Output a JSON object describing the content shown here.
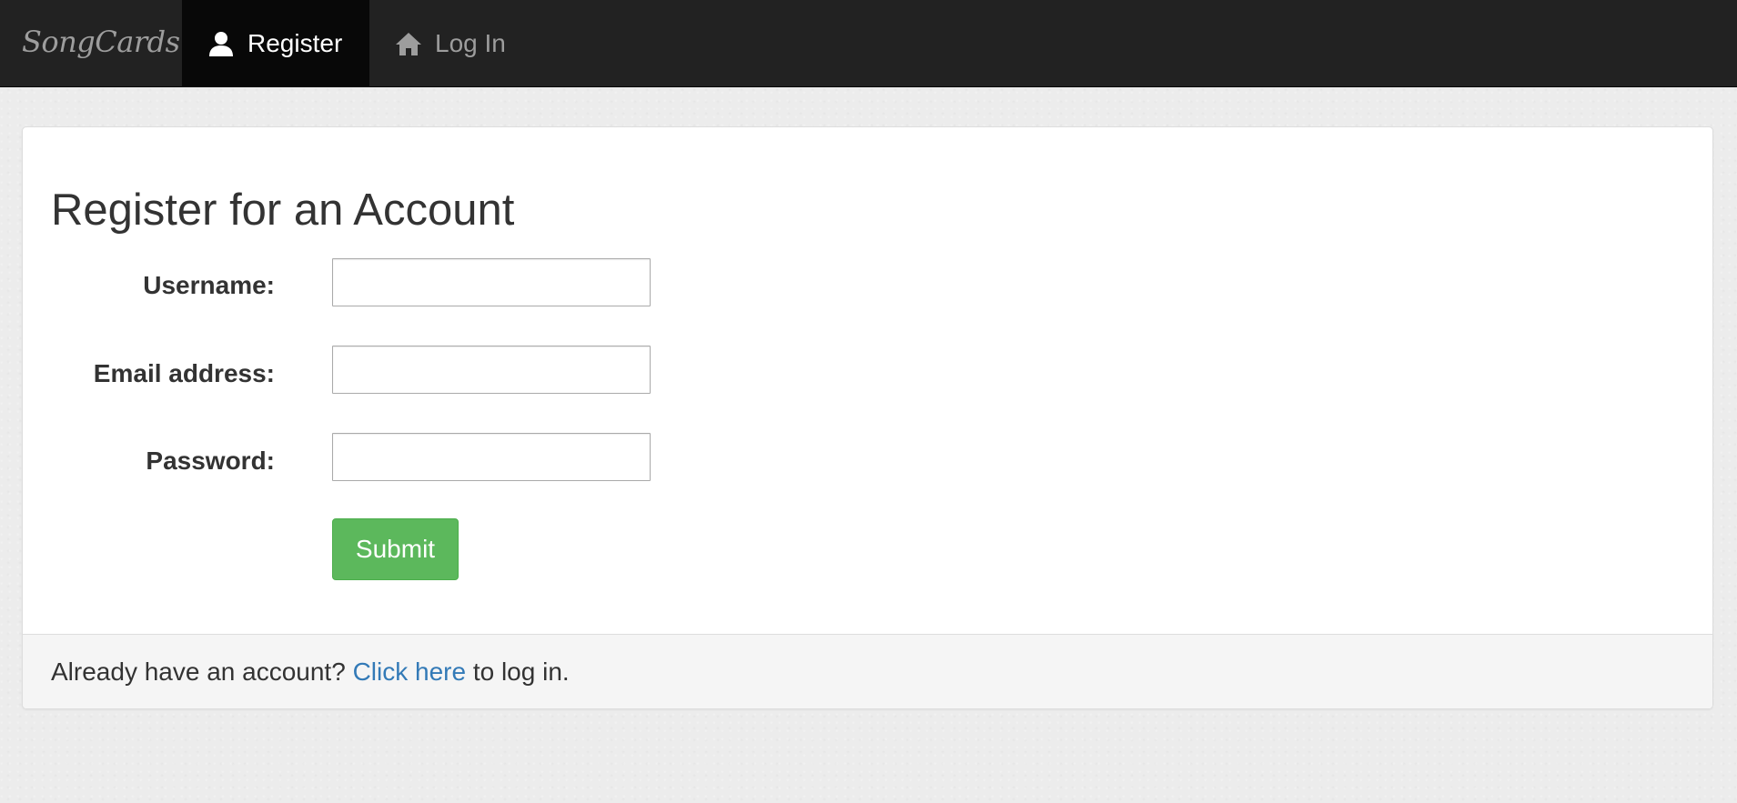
{
  "navbar": {
    "brand": "SongCards",
    "items": [
      {
        "label": "Register",
        "icon": "user-icon",
        "active": true
      },
      {
        "label": "Log In",
        "icon": "home-icon",
        "active": false
      }
    ],
    "colors": {
      "background": "#222222",
      "active_background": "#080808",
      "text": "#9d9d9d",
      "active_text": "#ffffff"
    }
  },
  "form": {
    "title": "Register for an Account",
    "fields": [
      {
        "label": "Username:",
        "value": ""
      },
      {
        "label": "Email address:",
        "value": ""
      },
      {
        "label": "Password:",
        "value": ""
      }
    ],
    "submit_label": "Submit",
    "submit_color": "#5cb85c"
  },
  "footer": {
    "prefix": "Already have an account? ",
    "link_text": "Click here",
    "suffix": " to log in.",
    "link_color": "#337ab7"
  }
}
